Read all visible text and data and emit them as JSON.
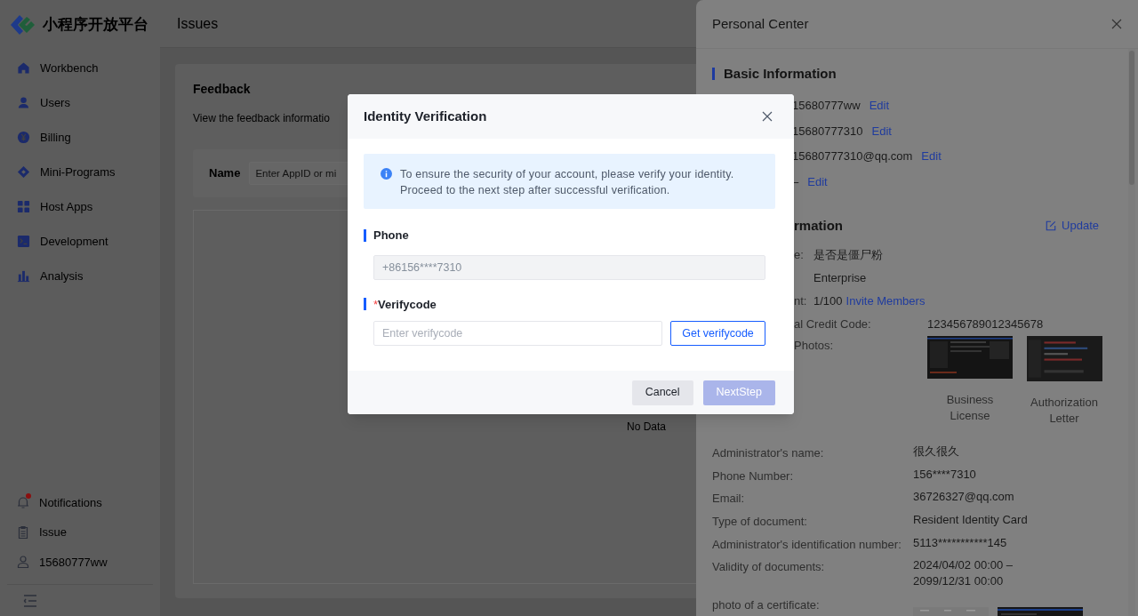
{
  "logo": {
    "text": "小程序开放平台"
  },
  "header": {
    "title": "Issues"
  },
  "sidebar": {
    "items": [
      {
        "label": "Workbench"
      },
      {
        "label": "Users"
      },
      {
        "label": "Billing"
      },
      {
        "label": "Mini-Programs"
      },
      {
        "label": "Host Apps"
      },
      {
        "label": "Development"
      },
      {
        "label": "Analysis"
      }
    ],
    "footer_items": [
      {
        "label": "Notifications",
        "unread": true
      },
      {
        "label": "Issue",
        "unread": false
      },
      {
        "label": "15680777ww",
        "unread": false
      }
    ]
  },
  "page": {
    "title": "Feedback",
    "description": "View the feedback informatio",
    "filter": {
      "label": "Name",
      "placeholder": "Enter AppID or mi"
    },
    "empty_text": "No Data"
  },
  "drawer": {
    "title": "Personal Center",
    "basic": {
      "title": "Basic Information",
      "rows": [
        {
          "value": "15680777ww",
          "link": "Edit"
        },
        {
          "value": "15680777310",
          "link": "Edit"
        },
        {
          "value": "15680777310@qq.com",
          "link": "Edit"
        },
        {
          "value": "–",
          "link": "Edit"
        }
      ]
    },
    "enterprise": {
      "title": "rmation",
      "action": "Update",
      "summary": [
        {
          "label": "e:",
          "value": "是否是僵尸粉"
        },
        {
          "value": "Enterprise"
        },
        {
          "label": "nt:",
          "value": "1/100",
          "link": "Invite Members"
        }
      ],
      "credit": {
        "label": "al Credit Code:",
        "value": "123456789012345678"
      },
      "photos": {
        "label": "Photos:",
        "items": [
          {
            "caption": "Business License"
          },
          {
            "caption": "Authorization Letter"
          }
        ]
      },
      "details": [
        {
          "label": "Administrator's name:",
          "value": "很久很久"
        },
        {
          "label": "Phone Number:",
          "value": "156****7310"
        },
        {
          "label": "Email:",
          "value": "36726327@qq.com"
        },
        {
          "label": "Type of document:",
          "value": "Resident Identity Card"
        },
        {
          "label": "Administrator's identification number:",
          "value": "5113***********145"
        },
        {
          "label": "Validity of documents:",
          "value": "2024/04/02 00:00 –\n2099/12/31 00:00"
        }
      ],
      "certificate": {
        "label": "photo of a certificate:"
      }
    }
  },
  "modal": {
    "title": "Identity Verification",
    "notice": "To ensure the security of your account, please verify your identity.\nProceed to the next step after successful verification.",
    "phone": {
      "label": "Phone",
      "value": "+86156****7310",
      "disabled": true
    },
    "code": {
      "label": "Verifycode",
      "required_mark": "*",
      "placeholder": "Enter verifycode",
      "button": "Get verifycode"
    },
    "buttons": [
      {
        "label": "Cancel",
        "kind": "secondary",
        "disabled": false
      },
      {
        "label": "NextStep",
        "kind": "primary",
        "disabled": true
      }
    ]
  }
}
